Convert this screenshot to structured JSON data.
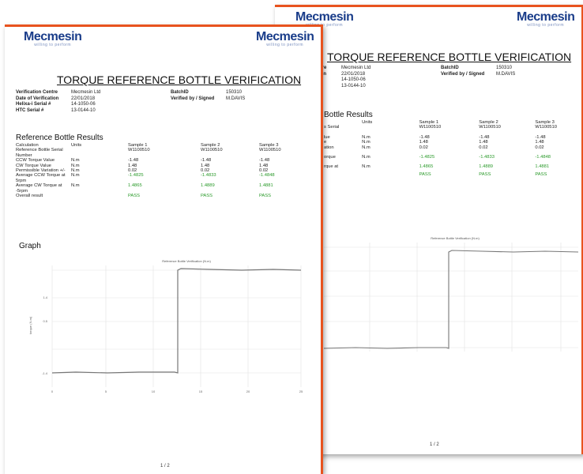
{
  "logo": {
    "text": "Mecmesin",
    "tagline": "willing to perform"
  },
  "title": "TORQUE REFERENCE BOTTLE VERIFICATION",
  "info_left": [
    {
      "label": "Verification Centre",
      "value": "Mecmesin Ltd"
    },
    {
      "label": "Date of Verification",
      "value": "22/01/2018"
    },
    {
      "label": "Helixa-i Serial #",
      "value": "14-1050-06"
    },
    {
      "label": "HTC Serial #",
      "value": "13-0144-10"
    }
  ],
  "info_right": [
    {
      "label": "BatchID",
      "value": "150310"
    },
    {
      "label": "Verified by / Signed",
      "value": "M.DAVIS"
    }
  ],
  "back_info_left": [
    {
      "label": "ntre",
      "value": "Mecmesin Ltd"
    },
    {
      "label": "tion",
      "value": "22/01/2018"
    },
    {
      "label": "#",
      "value": "14-1050-06"
    },
    {
      "label": "",
      "value": "13-0144-10"
    }
  ],
  "results_title": "Reference Bottle Results",
  "back_results_title": "Bottle Results",
  "results": {
    "headers": [
      "Calculation",
      "Units",
      "Sample 1",
      "Sample 2",
      "Sample 3"
    ],
    "rows": [
      [
        "Reference Bottle Serial Number",
        "",
        "W1100510",
        "W1100510",
        "W1100510"
      ],
      [
        "CCW Torque Value",
        "N.m",
        "-1.48",
        "-1.48",
        "-1.48"
      ],
      [
        "CW Torque Value",
        "N.m",
        "1.48",
        "1.48",
        "1.48"
      ],
      [
        "Permissible Variation +/-",
        "N.m",
        "0.02",
        "0.02",
        "0.02"
      ],
      [
        "Average CCW Torque at 5rpm",
        "N.m",
        "-1.4825",
        "-1.4833",
        "-1.4848"
      ],
      [
        "Average CW Torque at -5rpm",
        "N.m",
        "1.4865",
        "1.4889",
        "1.4881"
      ],
      [
        "Overall result",
        "",
        "PASS",
        "PASS",
        "PASS"
      ]
    ],
    "back_rows": [
      [
        "s Serial",
        "",
        "W1100510",
        "W1100510",
        "W1100510"
      ],
      [
        "lue",
        "N.m",
        "-1.48",
        "-1.48",
        "-1.48"
      ],
      [
        "e",
        "N.m",
        "1.48",
        "1.48",
        "1.48"
      ],
      [
        "ation",
        "N.m",
        "0.02",
        "0.02",
        "0.02"
      ],
      [
        "orque",
        "N.m",
        "-1.4825",
        "-1.4833",
        "-1.4848"
      ],
      [
        "rque at",
        "N.m",
        "1.4865",
        "1.4889",
        "1.4881"
      ],
      [
        "",
        "",
        "PASS",
        "PASS",
        "PASS"
      ]
    ]
  },
  "graph_title": "Graph",
  "chart_title": "Reference Bottle Verification (N.m)",
  "x_ticks": [
    "0",
    "5",
    "10",
    "15",
    "20",
    "25"
  ],
  "y_ticks": [
    "1.4",
    "0.5",
    "-1.4"
  ],
  "page_number": "1 / 2",
  "colors": {
    "accent": "#e8531e",
    "brand": "#1a3d8a",
    "pass": "#2a9a2a"
  }
}
